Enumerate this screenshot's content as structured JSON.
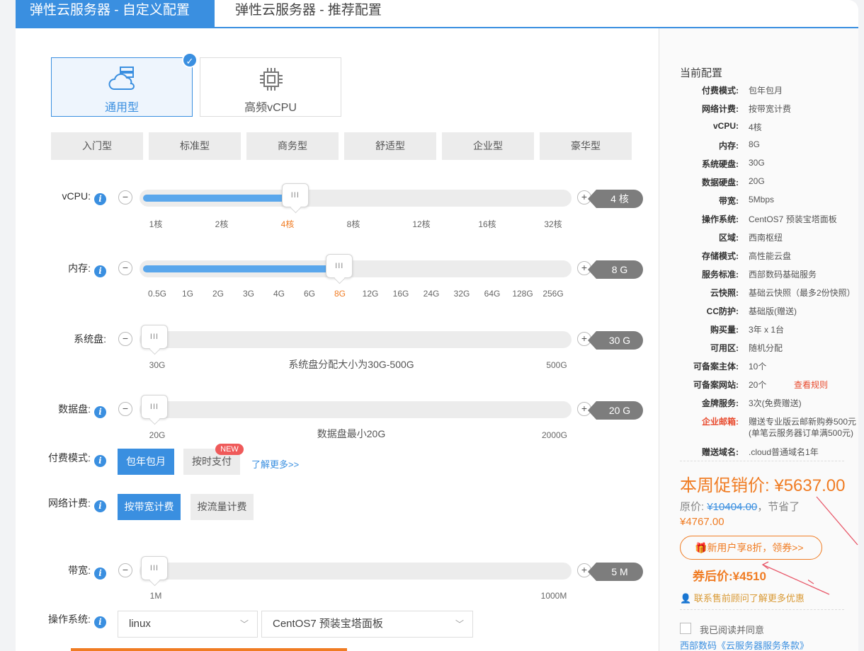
{
  "tabs": {
    "custom": "弹性云服务器 - 自定义配置",
    "recommended": "弹性云服务器 - 推荐配置"
  },
  "types": [
    {
      "label": "通用型",
      "selected": true
    },
    {
      "label": "高频vCPU",
      "selected": false
    }
  ],
  "presets": [
    "入门型",
    "标准型",
    "商务型",
    "舒适型",
    "企业型",
    "豪华型"
  ],
  "sliders": {
    "vcpu": {
      "label": "vCPU:",
      "value_tag": "4 核",
      "level": 0.35,
      "ticks": [
        "1核",
        "2核",
        "4核",
        "8核",
        "12核",
        "16核",
        "32核"
      ],
      "active_tick": 2
    },
    "memory": {
      "label": "内存:",
      "value_tag": "8 G",
      "level": 0.46,
      "ticks": [
        "0.5G",
        "1G",
        "2G",
        "3G",
        "4G",
        "6G",
        "8G",
        "12G",
        "16G",
        "24G",
        "32G",
        "64G",
        "128G",
        "256G"
      ],
      "active_tick": 6
    },
    "system_disk": {
      "label": "系统盘:",
      "value_tag": "30 G",
      "level": 0.0,
      "min": "30G",
      "max": "500G",
      "hint": "系统盘分配大小为30G-500G"
    },
    "data_disk": {
      "label": "数据盘:",
      "value_tag": "20 G",
      "level": 0.0,
      "min": "20G",
      "max": "2000G",
      "hint": "数据盘最小20G"
    },
    "bandwidth": {
      "label": "带宽:",
      "value_tag": "5 M",
      "level": 0.0,
      "min": "1M",
      "max": "1000M"
    }
  },
  "payment": {
    "label": "付费模式:",
    "options": [
      "包年包月",
      "按时支付"
    ],
    "new_badge": "NEW",
    "more_link": "了解更多>>"
  },
  "network": {
    "label": "网络计费:",
    "options": [
      "按带宽计费",
      "按流量计费"
    ]
  },
  "os": {
    "label": "操作系统:",
    "family": "linux",
    "image": "CentOS7 预装宝塔面板"
  },
  "summary": {
    "title": "当前配置",
    "rows": [
      {
        "k": "付费模式:",
        "v": "包年包月"
      },
      {
        "k": "网络计费:",
        "v": "按带宽计费"
      },
      {
        "k": "vCPU:",
        "v": "4核"
      },
      {
        "k": "内存:",
        "v": "8G"
      },
      {
        "k": "系统硬盘:",
        "v": "30G"
      },
      {
        "k": "数据硬盘:",
        "v": "20G"
      },
      {
        "k": "带宽:",
        "v": "5Mbps"
      },
      {
        "k": "操作系统:",
        "v": "CentOS7 预装宝塔面板"
      },
      {
        "k": "区域:",
        "v": "西南枢纽"
      },
      {
        "k": "存储模式:",
        "v": "高性能云盘"
      },
      {
        "k": "服务标准:",
        "v": "西部数码基础服务"
      },
      {
        "k": "云快照:",
        "v": "基础云快照（最多2份快照）"
      },
      {
        "k": "CC防护:",
        "v": "基础版(赠送)"
      },
      {
        "k": "购买量:",
        "v": "3年 x 1台"
      },
      {
        "k": "可用区:",
        "v": "随机分配"
      },
      {
        "k": "可备案主体:",
        "v": "10个"
      },
      {
        "k": "可备案网站:",
        "v": "20个",
        "extra": "查看规则"
      },
      {
        "k": "金牌服务:",
        "v": "3次(免费赠送)"
      }
    ],
    "mail": {
      "k": "企业邮箱:",
      "v1": "赠送专业版云邮新购券500元",
      "v2": "(单笔云服务器订单满500元)"
    },
    "domain": {
      "k": "赠送域名:",
      "v": ".cloud普通域名1年"
    },
    "promo_label": "本周促销价:",
    "promo_price": "¥5637.00",
    "orig_label": "原价:",
    "orig_price": "¥10404.00",
    "save_label": "，节省了",
    "save_amount": "¥4767.00",
    "coupon_text": "新用户享8折，",
    "coupon_link": "领券>>",
    "after_label": "券后价:",
    "after_price": "¥4510",
    "contact": "联系售前顾问了解更多优惠",
    "agree": "我已阅读并同意",
    "terms": "西部数码《云服务器服务条款》"
  },
  "colors": {
    "primary": "#3a8fe0",
    "accent": "#f07c23",
    "sale": "#f07c23",
    "badge": "#ef5a5a"
  }
}
